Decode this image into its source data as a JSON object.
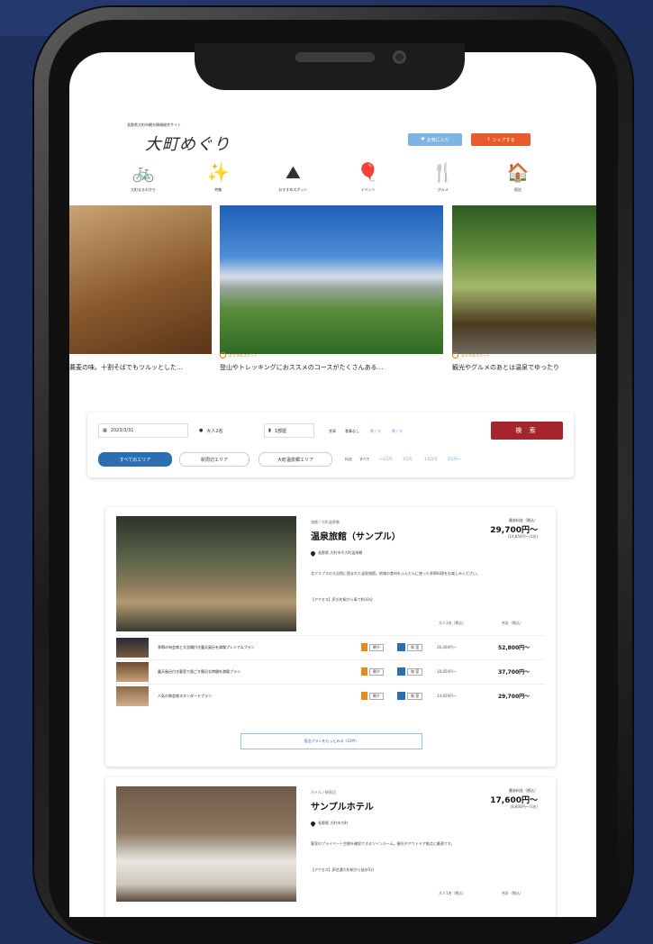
{
  "site": {
    "tagline": "長野県大町市観光情報総合サイト",
    "logo_text": "大町めぐり",
    "favorite_label": "お気に入り",
    "share_label": "シェアする"
  },
  "nav": [
    {
      "label": "大町まるわかり",
      "icon": "bicycle-icon",
      "glyph": "🚲"
    },
    {
      "label": "特集",
      "icon": "sparkle-icon",
      "glyph": "✨"
    },
    {
      "label": "おすすめスポット",
      "icon": "mountain-icon",
      "glyph": "⛰"
    },
    {
      "label": "イベント",
      "icon": "balloon-icon",
      "glyph": "🎈"
    },
    {
      "label": "グルメ",
      "icon": "cutlery-icon",
      "glyph": "🍴"
    },
    {
      "label": "宿泊",
      "icon": "house-icon",
      "glyph": "🏠"
    }
  ],
  "carousel": {
    "caption1": "蕎麦の味。十割そばでもツルッとした…",
    "tag2": "おすすめスポット",
    "caption2": "登山やトレッキングにおススメのコースがたくさんある…",
    "tag3": "おすすめスポット",
    "caption3": "観光やグルメのあとは温泉でゆったり"
  },
  "search": {
    "date": "2023/3/31",
    "people": "大人2名",
    "rooms": "1部屋",
    "meal_label": "食事",
    "meal_opts": [
      "食事なし",
      "朝 / 夕",
      "朝 / 夕"
    ],
    "price_label": "料金",
    "price_opts": [
      "すべて",
      "～1万円",
      "1万円",
      "1.5万円",
      "2万円～"
    ],
    "button": "検 索",
    "area_all": "すべてのエリア",
    "area_a": "駅周辺エリア",
    "area_b": "大町温泉郷エリア"
  },
  "listings": [
    {
      "category": "旅館 / 大町温泉郷",
      "name": "温泉旅館（サンプル）",
      "price_label": "最安料金（税込）",
      "price": "29,700円～",
      "price_sub": "(14,850円～/1名)",
      "address": "長野県 大町市平大町温泉郷",
      "desc": "北アルプスの大自然に囲まれた温泉旅館。地域の食材をふんだんに使った季節料理をお楽しみください。",
      "access": "【アクセス】JR大町駅から車で約10分",
      "plan_hdr1": "大人1名（税込）",
      "plan_hdr2": "合計（税込）",
      "plans": [
        {
          "name": "季節の旬会席と大浴場付き露天風呂を満喫プレミアムプラン",
          "meal": "朝夕",
          "room": "和 室",
          "p1": "26,400円～",
          "p2": "52,800円～"
        },
        {
          "name": "露天風呂付き客室で過ごす贅沢な時間を満喫プラン",
          "meal": "朝夕",
          "room": "和 室",
          "p1": "18,850円～",
          "p2": "37,700円～"
        },
        {
          "name": "人気の和会席スタンダードプラン",
          "meal": "朝夕",
          "room": "和 室",
          "p1": "14,850円～",
          "p2": "29,700円～"
        }
      ],
      "more": "宿泊プランをもっとみる（10件）"
    },
    {
      "category": "ホテル / 駅周辺",
      "name": "サンプルホテル",
      "price_label": "最安料金（税込）",
      "price": "17,600円～",
      "price_sub": "(8,800円～/1名)",
      "address": "長野県 大町市大町",
      "desc": "客室のプライベート空間を確保できるツインルーム。観光やアウトドア拠点に最適です。",
      "access": "【アクセス】JR信濃大町駅から徒歩5分",
      "plan_hdr1": "大人1名（税込）",
      "plan_hdr2": "合計（税込）"
    }
  ],
  "colors": {
    "accent": "#a4262c",
    "primary": "#2a6fb0",
    "orange": "#e85a2a"
  }
}
